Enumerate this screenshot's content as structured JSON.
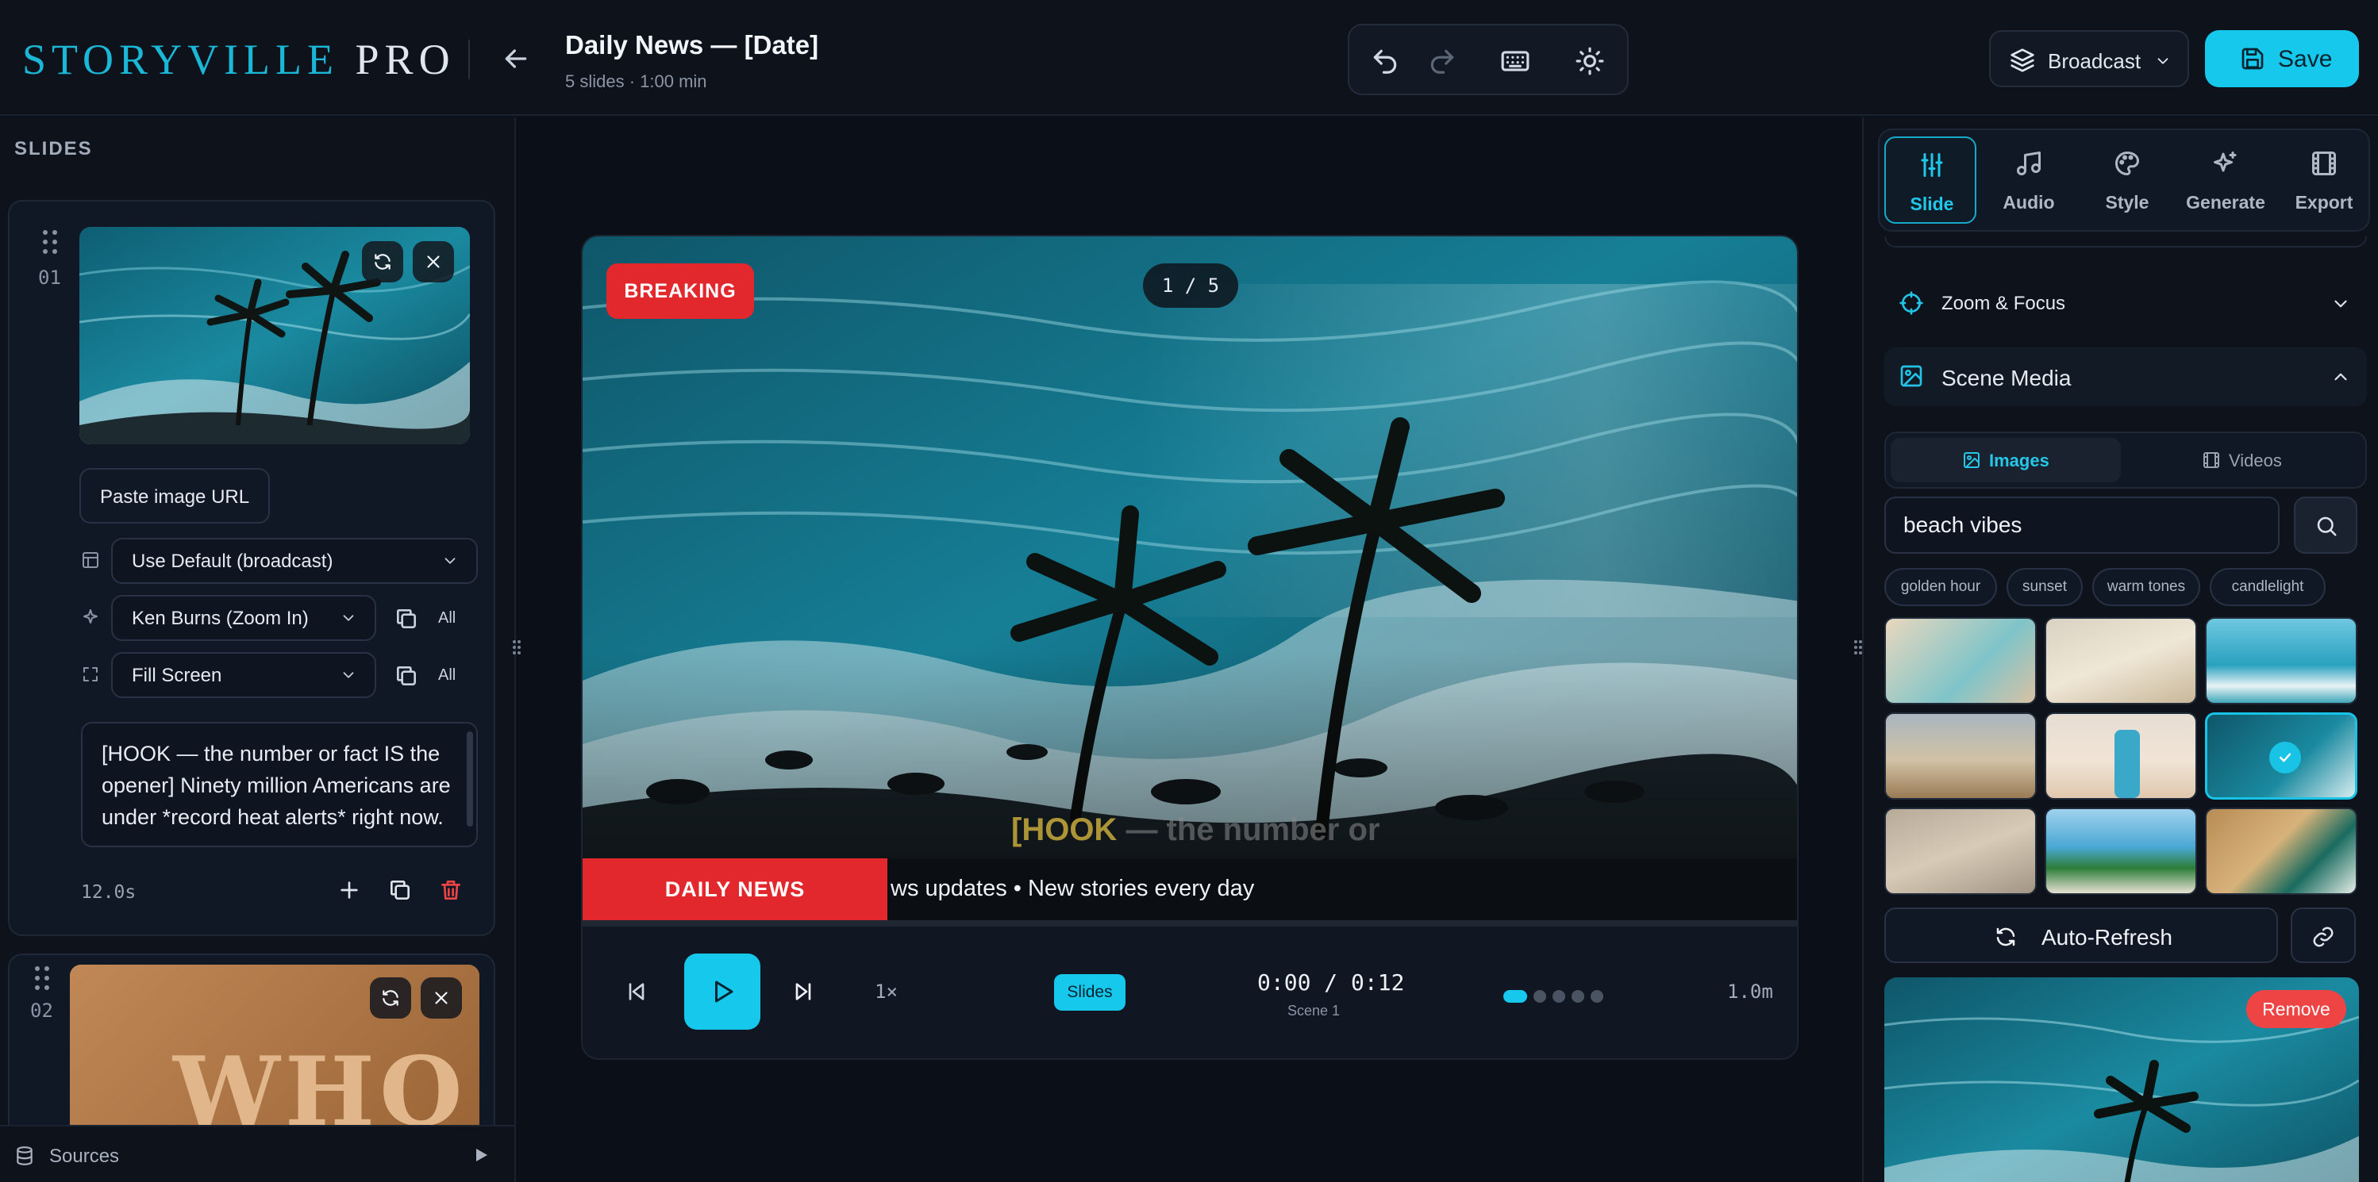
{
  "header": {
    "logo_main": "STORYVILLE ",
    "logo_pro": "PRO",
    "title": "Daily News — [Date]",
    "subtitle": "5 slides · 1:00 min",
    "mode": "Broadcast",
    "save_label": "Save"
  },
  "sidebar": {
    "heading": "SLIDES",
    "slides": [
      {
        "number": "01",
        "paste_label": "Paste image URL",
        "layout": "Use Default (broadcast)",
        "motion": "Ken Burns (Zoom In)",
        "fit": "Fill Screen",
        "all_label": "All",
        "script": "[HOOK — the number or fact IS the opener] Ninety million Americans are under *record heat alerts* right now.",
        "duration": "12.0s"
      },
      {
        "number": "02",
        "thumb_text": "WHO"
      }
    ],
    "sources_label": "Sources"
  },
  "player": {
    "badge": "BREAKING",
    "counter": "1 / 5",
    "caption_hook": "[HOOK",
    "caption_rest": " — the number or",
    "ticker_label": "DAILY NEWS",
    "ticker_text": "ws updates • New stories every day",
    "speed": "1×",
    "slides_pill": "Slides",
    "time": "0:00 / 0:12",
    "scene": "Scene 1",
    "length": "1.0m",
    "progress_dots": 5,
    "active_dot": 0
  },
  "rpanel": {
    "tabs": [
      {
        "label": "Slide",
        "icon": "sliders-icon"
      },
      {
        "label": "Audio",
        "icon": "music-icon"
      },
      {
        "label": "Style",
        "icon": "palette-icon"
      },
      {
        "label": "Generate",
        "icon": "sparkles-icon"
      },
      {
        "label": "Export",
        "icon": "film-icon"
      }
    ],
    "zoom_focus": "Zoom & Focus",
    "scene_media": "Scene Media",
    "media_tabs": {
      "images": "Images",
      "videos": "Videos"
    },
    "search": {
      "value": "beach vibes"
    },
    "chips": [
      "golden hour",
      "sunset",
      "warm tones",
      "candlelight"
    ],
    "auto_refresh": "Auto-Refresh",
    "remove_label": "Remove"
  },
  "colors": {
    "accent": "#16c8ec",
    "breaking_red": "#e2282c",
    "background": "#0b1018"
  }
}
